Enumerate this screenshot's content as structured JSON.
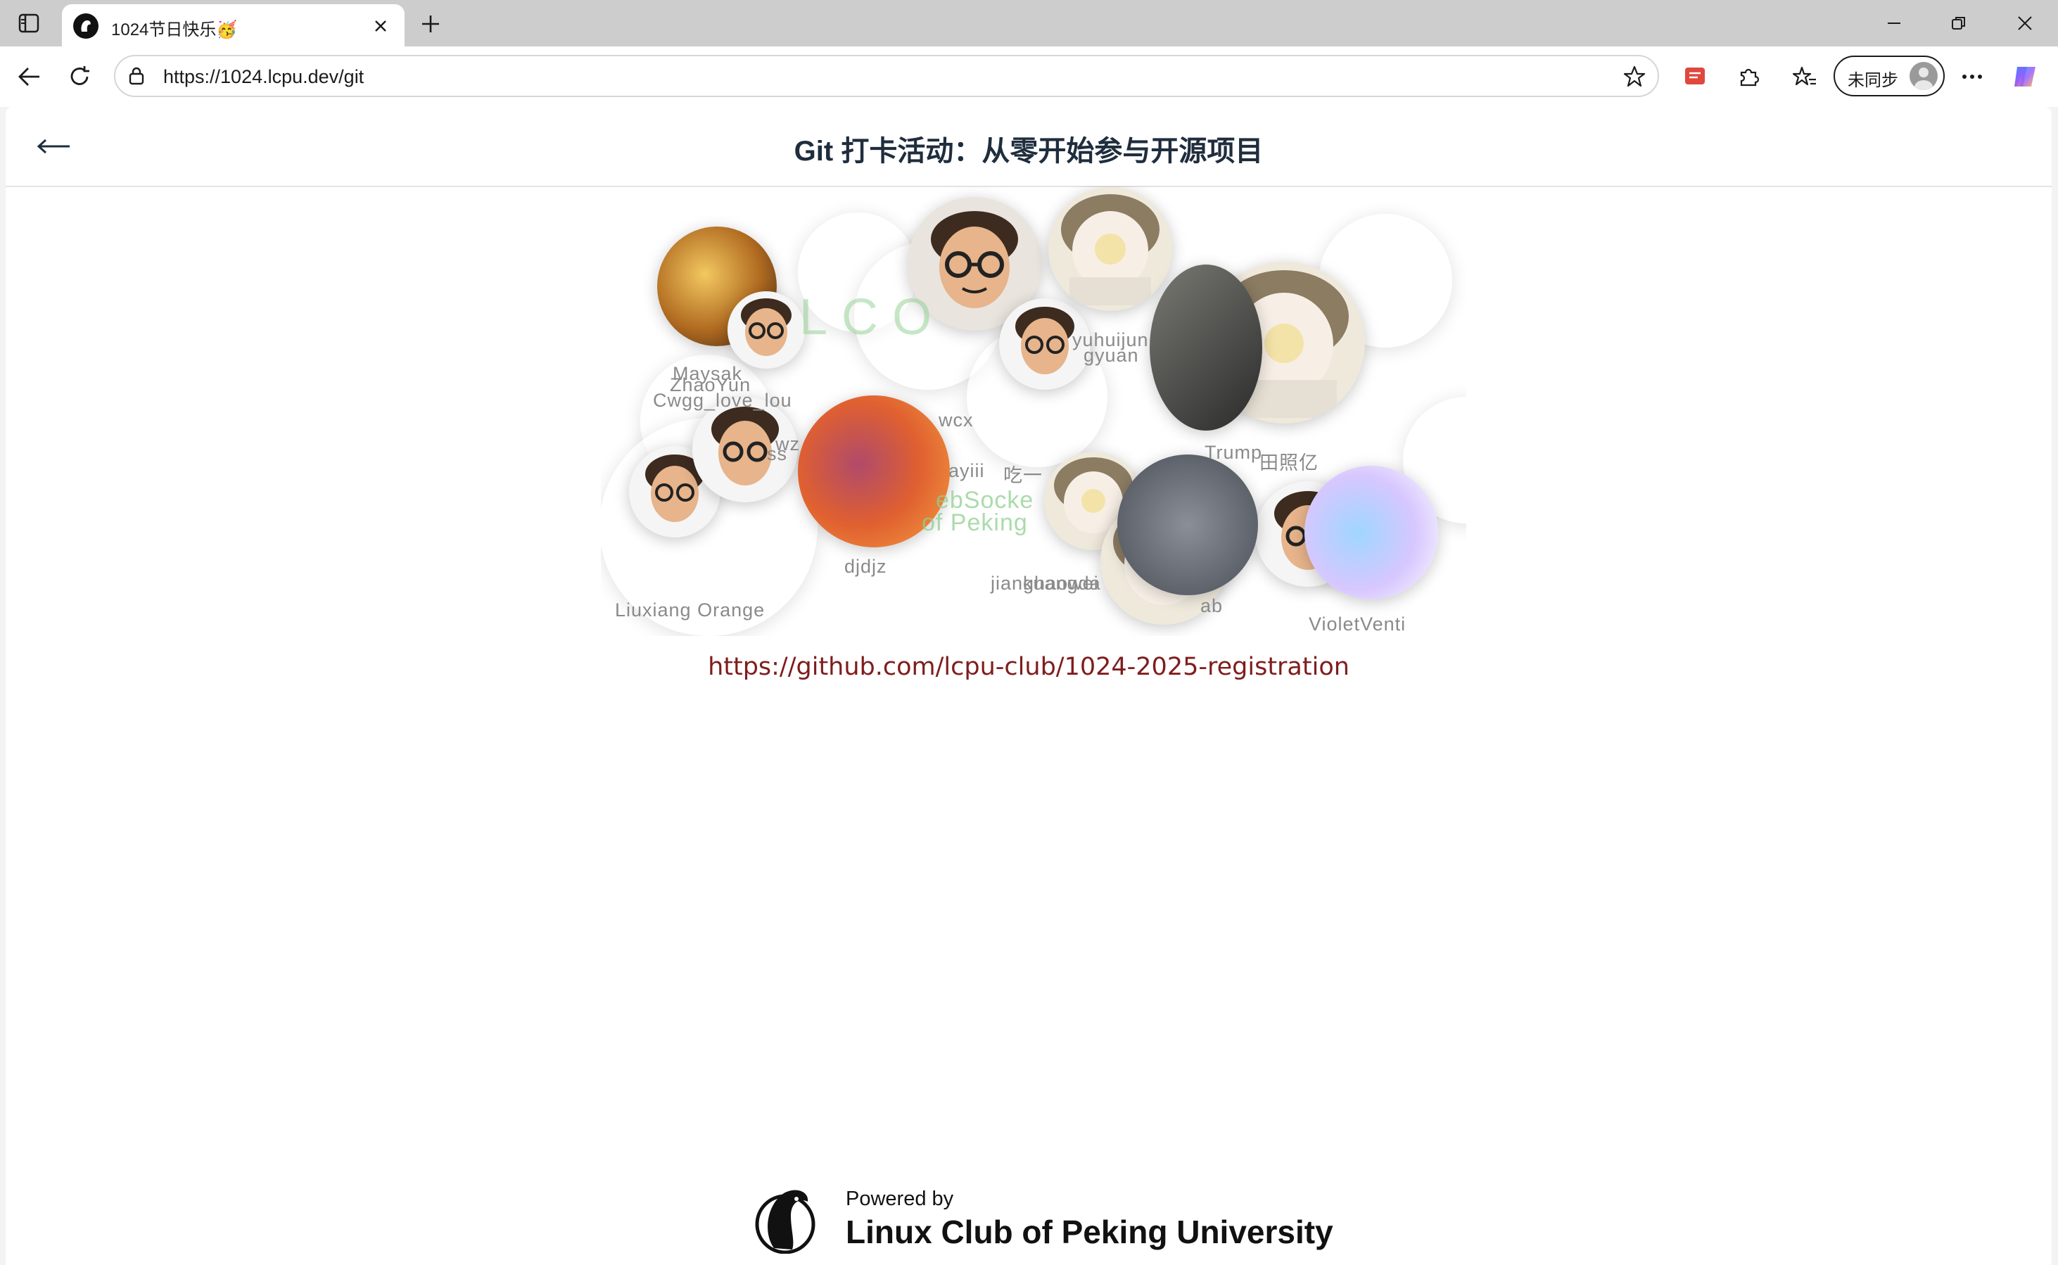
{
  "browser": {
    "tab_title": "1024节日快乐🥳",
    "url": "https://1024.lcpu.dev/git",
    "sync_label": "未同步"
  },
  "page": {
    "title": "Git 打卡活动：从零开始参与开源项目",
    "repo_link": "https://github.com/lcpu-club/1024-2025-registration",
    "footer_powered": "Powered by",
    "footer_club": "Linux Club of Peking University"
  },
  "cloud_labels": [
    "Maysak",
    "ZhaoYun",
    "Cwgg_love_lou",
    "wz",
    "ss",
    "wcx",
    "ayiii",
    "吃一",
    "ebSocke",
    "of Peking",
    "djdjz",
    "jianghaowei",
    "kuangda",
    "Trump",
    "田照亿",
    "ab",
    "Liuxiang Orange",
    "VioletVenti",
    "yuhuijun",
    "gyuan",
    "LCO"
  ],
  "icons": {
    "back": "arrow-left-icon",
    "tab_actions": "tab-actions-icon",
    "close": "close-icon",
    "new_tab": "plus-icon",
    "refresh": "refresh-icon",
    "favorite": "star-icon",
    "extensions": "puzzle-icon",
    "favorites": "favorites-icon",
    "more": "more-icon",
    "copilot": "copilot-icon"
  }
}
